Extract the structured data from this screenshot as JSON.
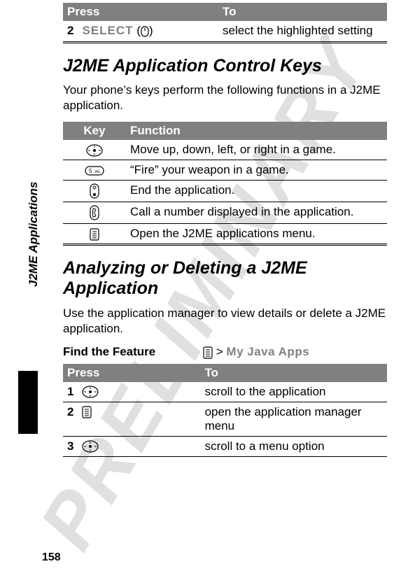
{
  "watermark": "PRELIMINARY",
  "sideLabel": "J2ME Applications",
  "pageNumber": "158",
  "topTable": {
    "headers": [
      "Press",
      "To"
    ],
    "row": {
      "num": "2",
      "select": "SELECT",
      "paren_open": "(",
      "paren_close": ")",
      "to": "select the highlighted setting"
    }
  },
  "heading1": "J2ME Application Control Keys",
  "para1": "Your phone’s keys perform the following functions in a J2ME application.",
  "keyTable": {
    "headers": [
      "Key",
      "Function"
    ],
    "rows": [
      {
        "fn": "Move up, down, left, or right in a game."
      },
      {
        "fn": "“Fire” your weapon in a game."
      },
      {
        "fn": "End the application."
      },
      {
        "fn": "Call a number displayed in the application."
      },
      {
        "fn": "Open the J2ME applications menu."
      }
    ]
  },
  "heading2": "Analyzing or Deleting a J2ME Application",
  "para2": "Use the application manager to view details or delete a J2ME application.",
  "feature": {
    "label": "Find the Feature",
    "sep": ">",
    "path": "My Java Apps"
  },
  "pressTable": {
    "headers": [
      "Press",
      "To"
    ],
    "rows": [
      {
        "num": "1",
        "to": "scroll to the application"
      },
      {
        "num": "2",
        "to": "open the application manager menu"
      },
      {
        "num": "3",
        "to": "scroll to a menu option"
      }
    ]
  }
}
